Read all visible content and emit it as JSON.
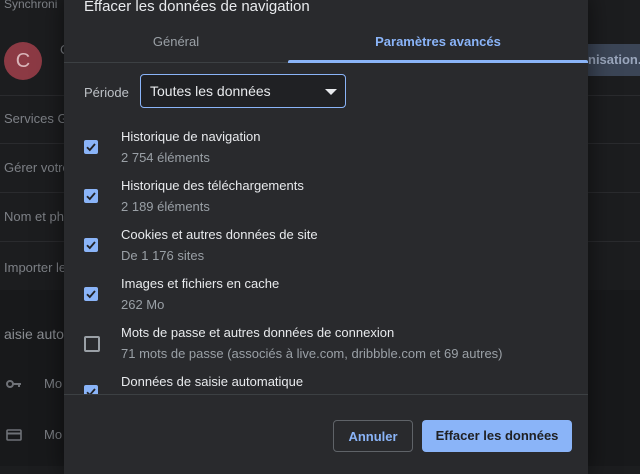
{
  "background": {
    "sync_header": "Synchroni",
    "avatar_letter": "C",
    "avatar_initial2": "C",
    "customize_button": "nisation...",
    "items": [
      "Services G",
      "Gérer votre",
      "Nom et ph",
      "Importer le"
    ],
    "section_header": "aisie autom",
    "section_items": [
      "Mo",
      "Mo"
    ]
  },
  "dialog": {
    "title": "Effacer les données de navigation",
    "tabs": {
      "general": "Général",
      "advanced": "Paramètres avancés"
    },
    "period": {
      "label": "Période",
      "selected": "Toutes les données"
    },
    "items": [
      {
        "title": "Historique de navigation",
        "subtitle": "2 754 éléments",
        "checked": true
      },
      {
        "title": "Historique des téléchargements",
        "subtitle": "2 189 éléments",
        "checked": true
      },
      {
        "title": "Cookies et autres données de site",
        "subtitle": "De 1 176 sites",
        "checked": true
      },
      {
        "title": "Images et fichiers en cache",
        "subtitle": "262 Mo",
        "checked": true
      },
      {
        "title": "Mots de passe et autres données de connexion",
        "subtitle": "71 mots de passe (associés à live.com, dribbble.com et 69 autres)",
        "checked": false
      },
      {
        "title": "Données de saisie automatique",
        "subtitle": "",
        "checked": true
      }
    ],
    "buttons": {
      "cancel": "Annuler",
      "clear": "Effacer les données"
    }
  },
  "colors": {
    "accent": "#8ab4f8",
    "dialog_bg": "#292a2d"
  }
}
